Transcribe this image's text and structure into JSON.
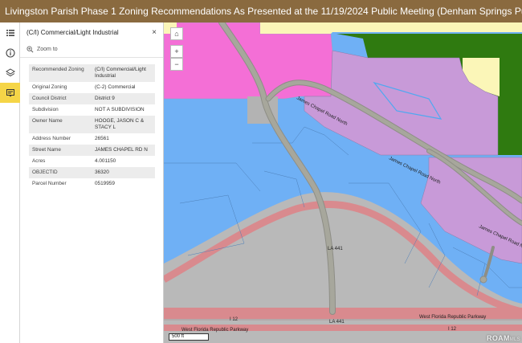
{
  "header": {
    "title": "Livingston Parish Phase 1 Zoning Recommendations As Presented at the 11/19/2024 Public Meeting (Denham Springs Public Library)"
  },
  "rail": {
    "icons": [
      "list-icon",
      "info-icon",
      "layers-icon",
      "popup-icon"
    ],
    "active": "popup-icon"
  },
  "panel": {
    "title": "(C/I) Commercial/Light Industrial",
    "zoom_label": "Zoom to",
    "close_glyph": "×",
    "rows": [
      {
        "key": "Recommended Zoning",
        "value": "(C/I) Commercial/Light Industrial"
      },
      {
        "key": "Original Zoning",
        "value": "(C-2) Commercial"
      },
      {
        "key": "Council District",
        "value": "District 9"
      },
      {
        "key": "Subdivision",
        "value": "NOT A SUBDIVISION"
      },
      {
        "key": "Owner Name",
        "value": "HOOGE, JASON C & STACY L"
      },
      {
        "key": "Address Number",
        "value": "26561"
      },
      {
        "key": "Street Name",
        "value": "JAMES CHAPEL RD N"
      },
      {
        "key": "Acres",
        "value": "4.001150"
      },
      {
        "key": "OBJECTID",
        "value": "36320"
      },
      {
        "key": "Parcel Number",
        "value": "0519959"
      }
    ]
  },
  "map": {
    "home_glyph": "⌂",
    "zoom_in_glyph": "+",
    "zoom_out_glyph": "−",
    "scale_label": "500 ft",
    "attribution": "ROAM",
    "attribution_suffix": "MLS",
    "road_labels": {
      "james_chapel_upper": "James Chapel Road North",
      "james_chapel_mid": "James Chapel Road North",
      "james_chapel_lower": "James Chapel Road North",
      "la441_upper": "LA 441",
      "la441_lower": "LA 441",
      "i12_left": "I 12",
      "i12_right": "I 12",
      "wfrp_upper": "West Florida Republic Parkway",
      "wfrp_lower": "West Florida Republic Parkway"
    },
    "colors": {
      "commercial_blue": "#6fb0f5",
      "residential_pink": "#f46fd6",
      "purple": "#c89ad8",
      "yellow": "#fbf6b8",
      "green": "#2f7a10",
      "road": "#a7a79c",
      "interchange": "#b9b9b9",
      "ramp": "#d98a8e"
    }
  }
}
